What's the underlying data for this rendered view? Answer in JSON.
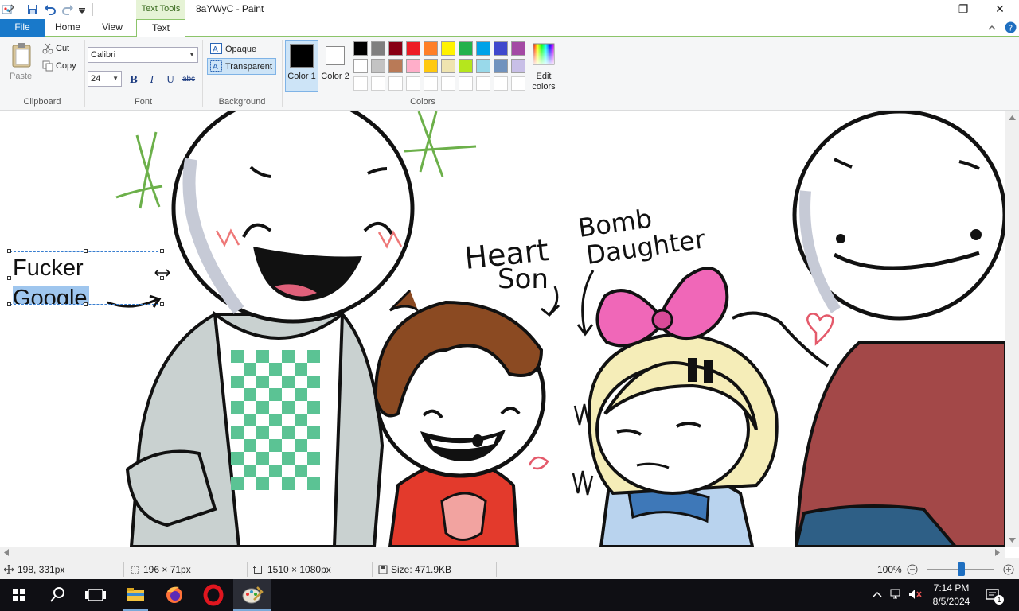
{
  "window": {
    "title": "8aYWyC - Paint",
    "contextual_tab_group": "Text Tools",
    "controls": {
      "minimize": "—",
      "maximize": "❐",
      "close": "✕"
    }
  },
  "tabs": [
    {
      "label": "File"
    },
    {
      "label": "Home"
    },
    {
      "label": "View"
    },
    {
      "label": "Text"
    }
  ],
  "ribbon": {
    "clipboard": {
      "paste": "Paste",
      "cut": "Cut",
      "copy": "Copy",
      "group": "Clipboard"
    },
    "font": {
      "family": "Calibri",
      "size": "24",
      "bold": "B",
      "italic": "I",
      "underline": "U",
      "strike": "abc",
      "group": "Font"
    },
    "background": {
      "opaque": "Opaque",
      "transparent": "Transparent",
      "group": "Background"
    },
    "colors": {
      "color1_label": "Color 1",
      "color2_label": "Color 2",
      "edit_label": "Edit colors",
      "group": "Colors",
      "color1": "#000000",
      "color2": "#ffffff",
      "palette_row1": [
        "#000000",
        "#7f7f7f",
        "#880015",
        "#ed1c24",
        "#ff7f27",
        "#fff200",
        "#22b14c",
        "#00a2e8",
        "#3f48cc",
        "#a349a4"
      ],
      "palette_row2": [
        "#ffffff",
        "#c3c3c3",
        "#b97a57",
        "#ffaec9",
        "#ffc90e",
        "#efe4b0",
        "#b5e61d",
        "#99d9ea",
        "#7092be",
        "#c8bfe7"
      ]
    }
  },
  "canvas": {
    "text_line1": "Fucker",
    "text_line2": "Google",
    "label_heart": "Heart",
    "label_son": "Son",
    "label_bomb": "Bomb",
    "label_daughter": "Daughter"
  },
  "status": {
    "cursor_pos": "198, 331px",
    "selection_size": "196 × 71px",
    "image_size": "1510 × 1080px",
    "file_size": "Size: 471.9KB",
    "zoom": "100%",
    "zoom_level": 0.5
  },
  "taskbar": {
    "time": "7:14 PM",
    "date": "8/5/2024",
    "apps": [
      "start-icon",
      "search-icon",
      "task-view-icon",
      "file-explorer-icon",
      "firefox-icon",
      "opera-icon",
      "paint-icon"
    ],
    "notification_count": "1"
  }
}
